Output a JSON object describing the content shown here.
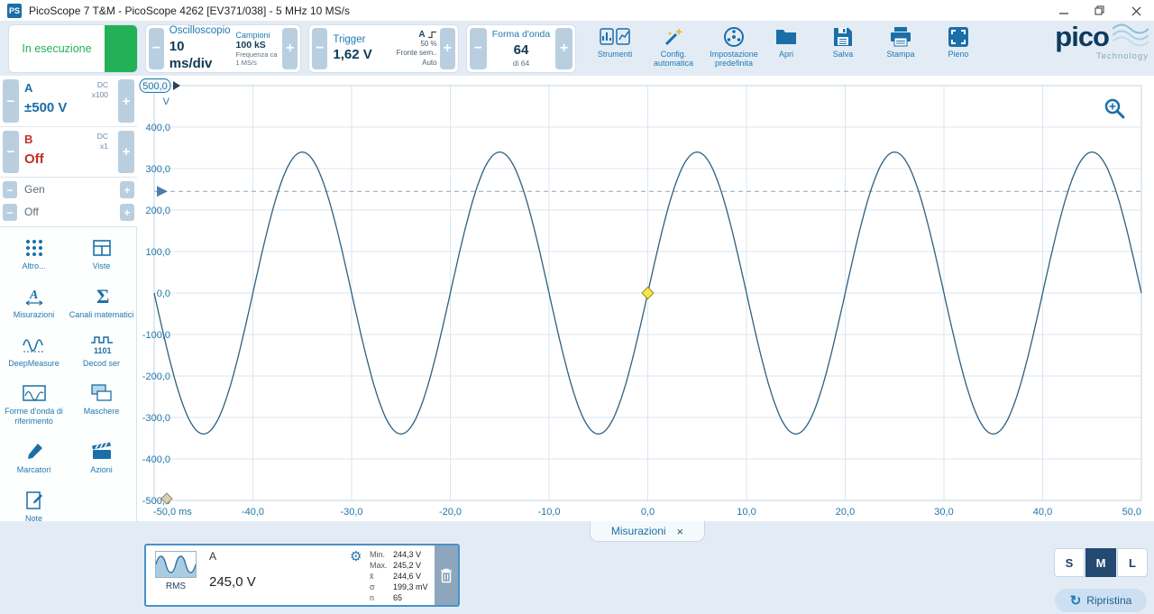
{
  "window": {
    "title": "PicoScope 7 T&M  - PicoScope 4262 [EV371/038] - 5 MHz 10 MS/s",
    "app_icon": "PS"
  },
  "glyphs": {
    "minus": "−",
    "plus": "+",
    "gear": "⚙",
    "restore": "↻"
  },
  "toolbar": {
    "run_button": {
      "label": "In esecuzione"
    },
    "timebase": {
      "title": "Oscilloscopio",
      "value": "10 ms/div"
    },
    "samples": {
      "title": "Campioni",
      "value": "100 kS",
      "rate_label": "Frequenza ca",
      "rate_value": "1 MS/s"
    },
    "trigger": {
      "title": "Trigger",
      "value": "1,62 V",
      "source": "A",
      "level_pct": "50 %",
      "edge": "Fronte sem..",
      "mode": "Auto"
    },
    "waveform": {
      "title": "Forma d'onda",
      "value": "64",
      "of": "di 64"
    },
    "buttons": {
      "tools": "Strumenti",
      "auto_setup": "Config. automatica",
      "default_setup": "Impostazione predefinita",
      "open": "Apri",
      "save": "Salva",
      "print": "Stampa",
      "full": "Pieno"
    },
    "logo": {
      "name": "pico",
      "sub": "Technology"
    }
  },
  "sidebar": {
    "channel_a": {
      "name": "A",
      "coupling": "DC",
      "probe": "x100",
      "range": "±500 V"
    },
    "channel_b": {
      "name": "B",
      "coupling": "DC",
      "probe": "x1",
      "range": "Off"
    },
    "generator": {
      "name": "Gen",
      "state": "Off"
    },
    "tools": [
      {
        "label": "Altro..."
      },
      {
        "label": "Viste"
      },
      {
        "label": "Misurazioni"
      },
      {
        "label": "Canali matematici"
      },
      {
        "label": "DeepMeasure"
      },
      {
        "label": "Decod ser"
      },
      {
        "label": "Forme d'onda di riferimento"
      },
      {
        "label": "Maschere"
      },
      {
        "label": "Marcatori"
      },
      {
        "label": "Azioni"
      },
      {
        "label": "Note"
      }
    ]
  },
  "chart_data": {
    "type": "line",
    "title": "",
    "xlabel_unit": "ms",
    "ylabel_unit": "V",
    "xlim": [
      -50,
      50
    ],
    "ylim": [
      -500,
      500
    ],
    "grid": true,
    "x_ticks": [
      -50,
      -40,
      -30,
      -20,
      -10,
      0,
      10,
      20,
      30,
      40,
      50
    ],
    "y_ticks": [
      500,
      400,
      300,
      200,
      100,
      0,
      -100,
      -200,
      -300,
      -400,
      -500
    ],
    "x_tick_labels": [
      "-50,0 ms",
      "-40,0",
      "-30,0",
      "-20,0",
      "-10,0",
      "0,0",
      "10,0",
      "20,0",
      "30,0",
      "40,0",
      "50,0"
    ],
    "y_tick_labels": [
      "500,0",
      "400,0",
      "300,0",
      "200,0",
      "100,0",
      "0,0",
      "-100,0",
      "-200,0",
      "-300,0",
      "-400,0",
      "-500,0"
    ],
    "series": [
      {
        "name": "A",
        "shape": "sine",
        "amplitude_v": 340,
        "period_ms": 20,
        "phase": "rising zero-crossing at 0 ms",
        "color": "#2e607f"
      }
    ],
    "trigger": {
      "level_v": 245,
      "time_ms": 0,
      "marker_y_v": 0
    }
  },
  "bottom": {
    "tab": {
      "label": "Misurazioni",
      "close": "×"
    },
    "measurement": {
      "channel": "A",
      "type": "RMS",
      "value": "245,0 V",
      "stats": [
        {
          "label": "Min.",
          "value": "244,3 V"
        },
        {
          "label": "Max.",
          "value": "245,2 V"
        },
        {
          "label": "x̄",
          "value": "244,6 V"
        },
        {
          "label": "σ",
          "value": "199,3 mV"
        },
        {
          "label": "n",
          "value": "65"
        }
      ]
    },
    "size_buttons": [
      {
        "label": "S",
        "selected": false
      },
      {
        "label": "M",
        "selected": true
      },
      {
        "label": "L",
        "selected": false
      }
    ],
    "restore_button": "Ripristina"
  }
}
